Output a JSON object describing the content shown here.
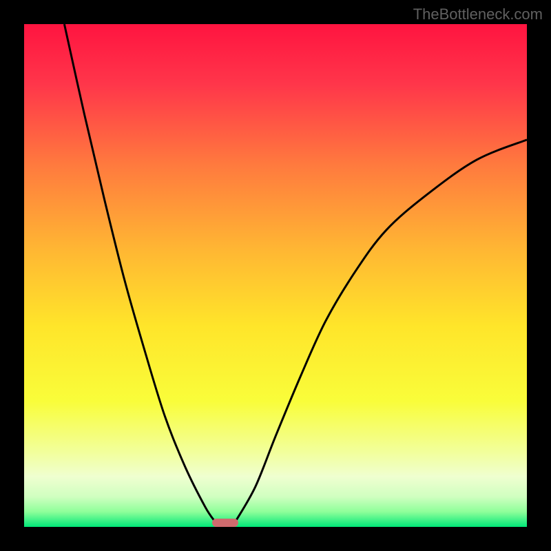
{
  "watermark": "TheBottleneck.com",
  "chart_data": {
    "type": "line",
    "title": "",
    "xlabel": "",
    "ylabel": "",
    "xlim": [
      0,
      100
    ],
    "ylim": [
      0,
      100
    ],
    "background_gradient": {
      "stops": [
        {
          "pos": 0.0,
          "color": "#ff1440"
        },
        {
          "pos": 0.12,
          "color": "#ff364a"
        },
        {
          "pos": 0.28,
          "color": "#ff7a3e"
        },
        {
          "pos": 0.45,
          "color": "#ffb733"
        },
        {
          "pos": 0.6,
          "color": "#ffe52a"
        },
        {
          "pos": 0.75,
          "color": "#f9fd3a"
        },
        {
          "pos": 0.85,
          "color": "#f2ff9a"
        },
        {
          "pos": 0.9,
          "color": "#efffd0"
        },
        {
          "pos": 0.94,
          "color": "#d0ffc0"
        },
        {
          "pos": 0.97,
          "color": "#8eff9a"
        },
        {
          "pos": 1.0,
          "color": "#00e778"
        }
      ]
    },
    "series": [
      {
        "name": "left-branch",
        "color": "#000000",
        "x": [
          8,
          12,
          16,
          20,
          24,
          28,
          32,
          36,
          38
        ],
        "y": [
          100,
          82,
          65,
          49,
          35,
          22,
          12,
          4,
          1
        ]
      },
      {
        "name": "right-branch",
        "color": "#000000",
        "x": [
          42,
          46,
          50,
          55,
          60,
          66,
          72,
          80,
          90,
          100
        ],
        "y": [
          1,
          8,
          18,
          30,
          41,
          51,
          59,
          66,
          73,
          77
        ]
      }
    ],
    "marker": {
      "x": 40,
      "y": 0.8,
      "color": "#cf6b6e",
      "shape": "pill"
    }
  }
}
